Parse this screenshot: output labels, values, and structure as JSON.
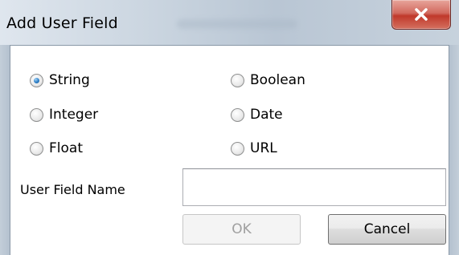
{
  "window": {
    "title": "Add User Field"
  },
  "field_types": {
    "selected": "String",
    "options": [
      "String",
      "Boolean",
      "Integer",
      "Date",
      "Float",
      "URL"
    ]
  },
  "name_field": {
    "label": "User Field Name",
    "value": ""
  },
  "buttons": {
    "ok": "OK",
    "cancel": "Cancel",
    "ok_enabled": false
  },
  "icons": {
    "close": "close-icon"
  },
  "colors": {
    "title_bar": "#c9d4df",
    "close_button": "#c0392b",
    "radio_selected": "#2f7fc6"
  }
}
